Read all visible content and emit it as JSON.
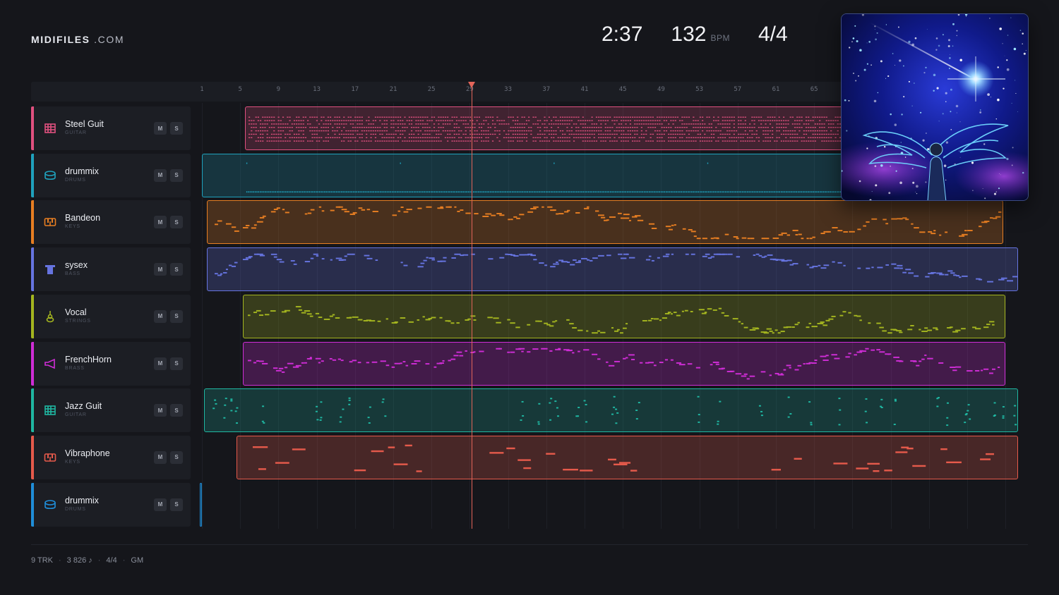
{
  "brand": {
    "name": "MIDIFILES",
    "domain": ".COM"
  },
  "transport": {
    "time": "2:37",
    "bpm": "132",
    "bpm_unit": "BPM",
    "signature": "4/4"
  },
  "ruler": {
    "bars": [
      "1",
      "5",
      "9",
      "13",
      "17",
      "21",
      "25",
      "29",
      "33",
      "37",
      "41",
      "45",
      "49",
      "53",
      "57",
      "61",
      "65"
    ]
  },
  "playhead": {
    "bar": 29.2
  },
  "tracks": [
    {
      "name": "Steel Guit",
      "category": "GUITAR",
      "color": "#e0507f",
      "icon": "guitar-icon",
      "mute": "M",
      "solo": "S",
      "region": [
        5.5,
        999
      ]
    },
    {
      "name": "drummix",
      "category": "DRUMS",
      "color": "#1fa2bd",
      "icon": "drum-icon",
      "mute": "M",
      "solo": "S",
      "region": [
        1,
        999
      ]
    },
    {
      "name": "Bandeon",
      "category": "KEYS",
      "color": "#e77e22",
      "icon": "keys-icon",
      "mute": "M",
      "solo": "S",
      "region": [
        1.5,
        84.8
      ]
    },
    {
      "name": "sysex",
      "category": "BASS",
      "color": "#6674e0",
      "icon": "bass-icon",
      "mute": "M",
      "solo": "S",
      "region": [
        1.5,
        86.4
      ]
    },
    {
      "name": "Vocal",
      "category": "STRINGS",
      "color": "#a4b51f",
      "icon": "strings-icon",
      "mute": "M",
      "solo": "S",
      "region": [
        5.3,
        85
      ]
    },
    {
      "name": "FrenchHorn",
      "category": "BRASS",
      "color": "#cf2dd6",
      "icon": "brass-icon",
      "mute": "M",
      "solo": "S",
      "region": [
        5.3,
        85
      ]
    },
    {
      "name": "Jazz Guit",
      "category": "GUITAR",
      "color": "#1fb7a2",
      "icon": "guitar-icon",
      "mute": "M",
      "solo": "S",
      "region": [
        1.2,
        86.4
      ]
    },
    {
      "name": "Vibraphone",
      "category": "KEYS",
      "color": "#e55a4b",
      "icon": "keys-icon",
      "mute": "M",
      "solo": "S",
      "region": [
        4.6,
        86.4
      ]
    },
    {
      "name": "drummix",
      "category": "DRUMS",
      "color": "#1f8ed9",
      "icon": "drum-icon",
      "mute": "M",
      "solo": "S",
      "region": [
        0.8,
        1.0
      ]
    }
  ],
  "footer": {
    "tracks": "9 TRK",
    "notes": "3 826 ♪",
    "signature": "4/4",
    "standard": "GM",
    "separator": "·"
  },
  "cover": {
    "alt": "starfield-angel-artwork"
  }
}
